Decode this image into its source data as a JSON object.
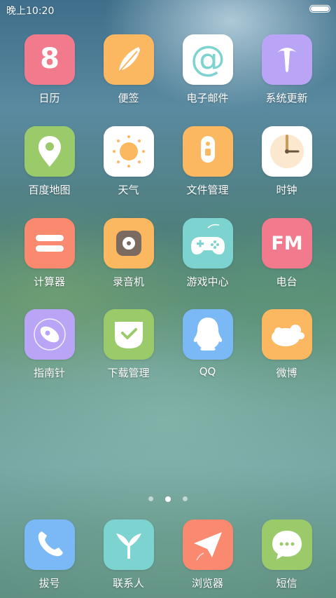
{
  "status_bar": {
    "time": "晚上10:20"
  },
  "apps": [
    {
      "id": "calendar",
      "label": "日历",
      "color": "#f27a8d",
      "icon": "calendar-icon",
      "icon_text": "8"
    },
    {
      "id": "notes",
      "label": "便签",
      "color": "#fbb860",
      "icon": "feather-icon"
    },
    {
      "id": "email",
      "label": "电子邮件",
      "color": "#ffffff",
      "icon": "at-sign-icon",
      "icon_text": "@"
    },
    {
      "id": "system-update",
      "label": "系统更新",
      "color": "#b9a4f6",
      "icon": "update-arrow-icon"
    },
    {
      "id": "baidu-maps",
      "label": "百度地图",
      "color": "#9bca6a",
      "icon": "map-pin-icon"
    },
    {
      "id": "weather",
      "label": "天气",
      "color": "#ffffff",
      "icon": "sun-icon"
    },
    {
      "id": "file-manager",
      "label": "文件管理",
      "color": "#fbb860",
      "icon": "usb-drive-icon"
    },
    {
      "id": "clock",
      "label": "时钟",
      "color": "#ffffff",
      "icon": "clock-icon"
    },
    {
      "id": "calculator",
      "label": "计算器",
      "color": "#fa8a6f",
      "icon": "equals-icon"
    },
    {
      "id": "recorder",
      "label": "录音机",
      "color": "#fbb860",
      "icon": "recorder-icon"
    },
    {
      "id": "game-center",
      "label": "游戏中心",
      "color": "#7cd3cf",
      "icon": "gamepad-icon"
    },
    {
      "id": "radio",
      "label": "电台",
      "color": "#f27a8d",
      "icon": "fm-radio-icon",
      "icon_text": "FM"
    },
    {
      "id": "compass",
      "label": "指南针",
      "color": "#b9a4f6",
      "icon": "compass-icon"
    },
    {
      "id": "download-manager",
      "label": "下载管理",
      "color": "#9bca6a",
      "icon": "download-check-icon"
    },
    {
      "id": "qq",
      "label": "QQ",
      "color": "#7ab8f6",
      "icon": "qq-penguin-icon"
    },
    {
      "id": "weibo",
      "label": "微博",
      "color": "#fbb860",
      "icon": "weibo-cloud-icon"
    }
  ],
  "page_indicator": {
    "pages": 3,
    "active": 2
  },
  "dock": [
    {
      "id": "dialer",
      "label": "拔号",
      "color": "#7ab8f6",
      "icon": "phone-icon"
    },
    {
      "id": "contacts",
      "label": "联系人",
      "color": "#7cd3cf",
      "icon": "contacts-icon"
    },
    {
      "id": "browser",
      "label": "浏览器",
      "color": "#fa8a6f",
      "icon": "paper-plane-icon"
    },
    {
      "id": "messages",
      "label": "短信",
      "color": "#9bca6a",
      "icon": "message-bubble-icon"
    }
  ]
}
